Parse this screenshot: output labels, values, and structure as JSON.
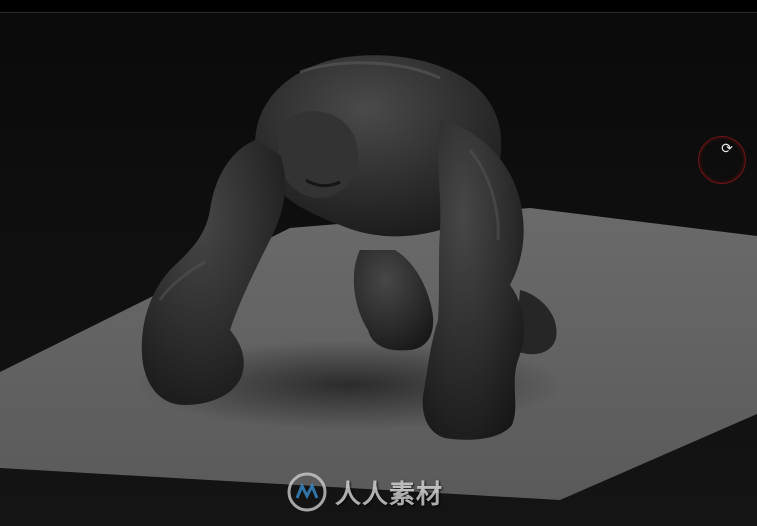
{
  "viewport": {
    "background": "#0d0d0d",
    "floor_color": "#5c5c5c",
    "model_color": "#2e2e2e"
  },
  "rotate_widget": {
    "icon": "rotate-icon",
    "ring_color": "#6e1414"
  },
  "watermark": {
    "text": "人人素材",
    "logo": "cg-logo-icon"
  }
}
